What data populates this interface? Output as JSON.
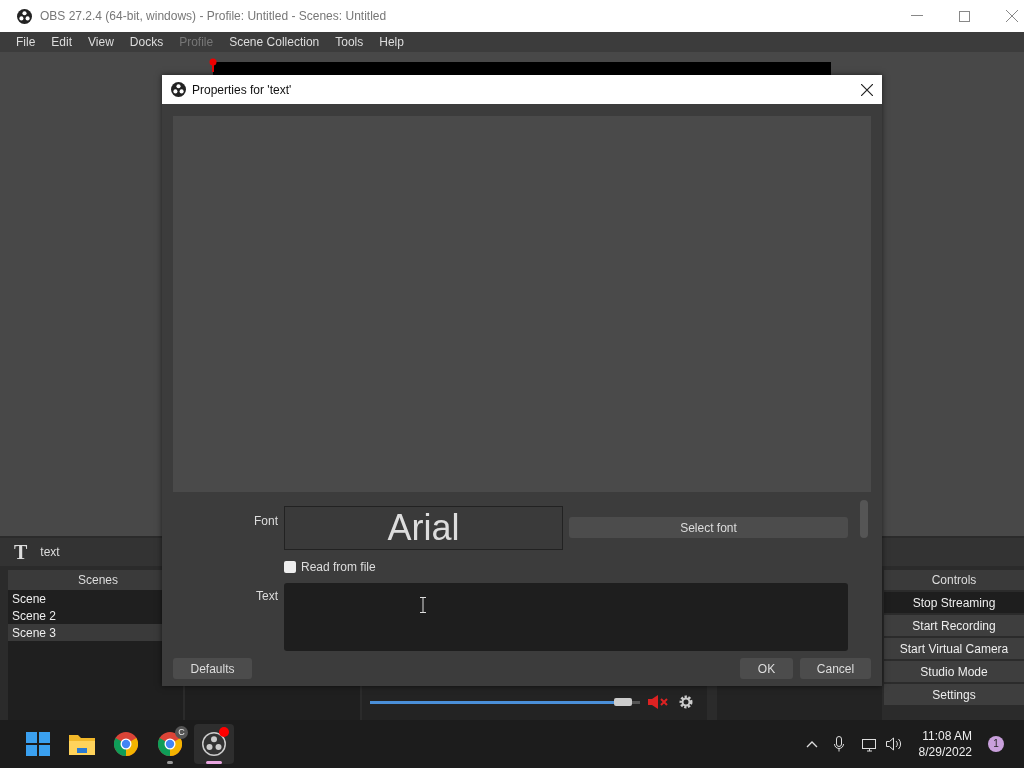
{
  "window": {
    "title": "OBS 27.2.4 (64-bit, windows) - Profile: Untitled - Scenes: Untitled"
  },
  "menu": [
    {
      "label": "File",
      "disabled": false
    },
    {
      "label": "Edit",
      "disabled": false
    },
    {
      "label": "View",
      "disabled": false
    },
    {
      "label": "Docks",
      "disabled": false
    },
    {
      "label": "Profile",
      "disabled": true
    },
    {
      "label": "Scene Collection",
      "disabled": false
    },
    {
      "label": "Tools",
      "disabled": false
    },
    {
      "label": "Help",
      "disabled": false
    }
  ],
  "context_bar": {
    "icon": "T",
    "source_name": "text"
  },
  "scenes": {
    "title": "Scenes",
    "items": [
      {
        "label": "Scene",
        "selected": false
      },
      {
        "label": "Scene 2",
        "selected": false
      },
      {
        "label": "Scene 3",
        "selected": true
      }
    ]
  },
  "mixer": {
    "level": 0.97,
    "muted": true
  },
  "controls": {
    "title": "Controls",
    "buttons": [
      {
        "label": "Stop Streaming",
        "active": true
      },
      {
        "label": "Start Recording",
        "active": false
      },
      {
        "label": "Start Virtual Camera",
        "active": false
      },
      {
        "label": "Studio Mode",
        "active": false
      },
      {
        "label": "Settings",
        "active": false
      }
    ]
  },
  "dialog": {
    "title": "Properties for 'text'",
    "font_label": "Font",
    "font_name": "Arial",
    "select_font_button": "Select font",
    "read_from_file": {
      "label": "Read from file",
      "checked": false
    },
    "text_label": "Text",
    "defaults_button": "Defaults",
    "ok_button": "OK",
    "cancel_button": "Cancel"
  },
  "taskbar": {
    "apps": [
      {
        "kind": "start",
        "selected": false,
        "running": false
      },
      {
        "kind": "folder",
        "selected": false,
        "running": false
      },
      {
        "kind": "chrome",
        "selected": false,
        "running": false
      },
      {
        "kind": "chrome",
        "selected": false,
        "running": true,
        "badge": "C"
      },
      {
        "kind": "obs",
        "selected": true,
        "running": true
      }
    ],
    "time": "11:08 AM",
    "date": "8/29/2022",
    "notification_count": "1"
  }
}
